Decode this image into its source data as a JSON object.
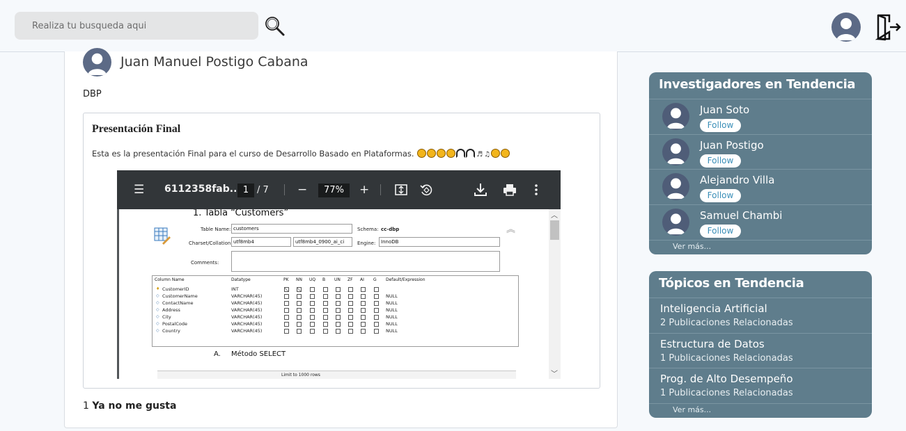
{
  "search": {
    "placeholder": "Realiza tu busqueda aqui"
  },
  "icons": {
    "search": "search-icon",
    "avatar": "user-avatar-icon",
    "logout": "logout-icon"
  },
  "post": {
    "author": "Juan Manuel Postigo Cabana",
    "course": "DBP",
    "publication": {
      "title": "Presentación Final",
      "description": "Esta es la presentación Final para el curso de Desarrollo Basado en Plataformas.",
      "emojis": [
        "sunglasses-face",
        "sunglasses-face",
        "sunglasses-face",
        "sunglasses-face",
        "headphones",
        "headphones",
        "music-note",
        "music-notes",
        "grinning-face",
        "grinning-face"
      ]
    },
    "pdf_viewer": {
      "filename": "6112358fab...",
      "current_page": "1",
      "total_pages": "/ 7",
      "zoom": "77%",
      "document": {
        "heading": "1.  Tabla “Customers”",
        "table_name_label": "Table Name:",
        "table_name_value": "customers",
        "schema_label": "Schema:",
        "schema_value": "cc-dbp",
        "charset_label": "Charset/Collation:",
        "charset_value": "utf8mb4",
        "collation_value": "utf8mb4_0900_ai_ci",
        "engine_label": "Engine:",
        "engine_value": "InnoDB",
        "comments_label": "Comments:",
        "grid_columns": [
          "Column Name",
          "Datatype",
          "PK",
          "NN",
          "UQ",
          "B",
          "UN",
          "ZF",
          "AI",
          "G",
          "Default/Expression"
        ],
        "grid_rows": [
          {
            "name": "CustomerID",
            "type": "INT",
            "default": ""
          },
          {
            "name": "CustomerName",
            "type": "VARCHAR(45)",
            "default": "NULL"
          },
          {
            "name": "ContactName",
            "type": "VARCHAR(45)",
            "default": "NULL"
          },
          {
            "name": "Address",
            "type": "VARCHAR(45)",
            "default": "NULL"
          },
          {
            "name": "City",
            "type": "VARCHAR(45)",
            "default": "NULL"
          },
          {
            "name": "PostalCode",
            "type": "VARCHAR(45)",
            "default": "NULL"
          },
          {
            "name": "Country",
            "type": "VARCHAR(45)",
            "default": "NULL"
          }
        ],
        "subheading_letter": "A.",
        "subheading": "Método SELECT",
        "toolbar_limit": "Limit to 1000 rows"
      }
    },
    "likes_count": "1",
    "likes_label": "Ya no me gusta"
  },
  "trending_researchers": {
    "title": "Investigadores en Tendencia",
    "follow_label": "Follow",
    "items": [
      {
        "name": "Juan Soto"
      },
      {
        "name": "Juan Postigo"
      },
      {
        "name": "Alejandro Villa"
      },
      {
        "name": "Samuel Chambi"
      }
    ],
    "more": "Ver más..."
  },
  "trending_topics": {
    "title": "Tópicos en Tendencia",
    "items": [
      {
        "name": "Inteligencia Artificial",
        "count": "2 Publicaciones Relacionadas"
      },
      {
        "name": "Estructura de Datos",
        "count": "1 Publicaciones Relacionadas"
      },
      {
        "name": "Prog. de Alto Desempeño",
        "count": "1 Publicaciones Relacionadas"
      }
    ],
    "more": "Ver más..."
  }
}
